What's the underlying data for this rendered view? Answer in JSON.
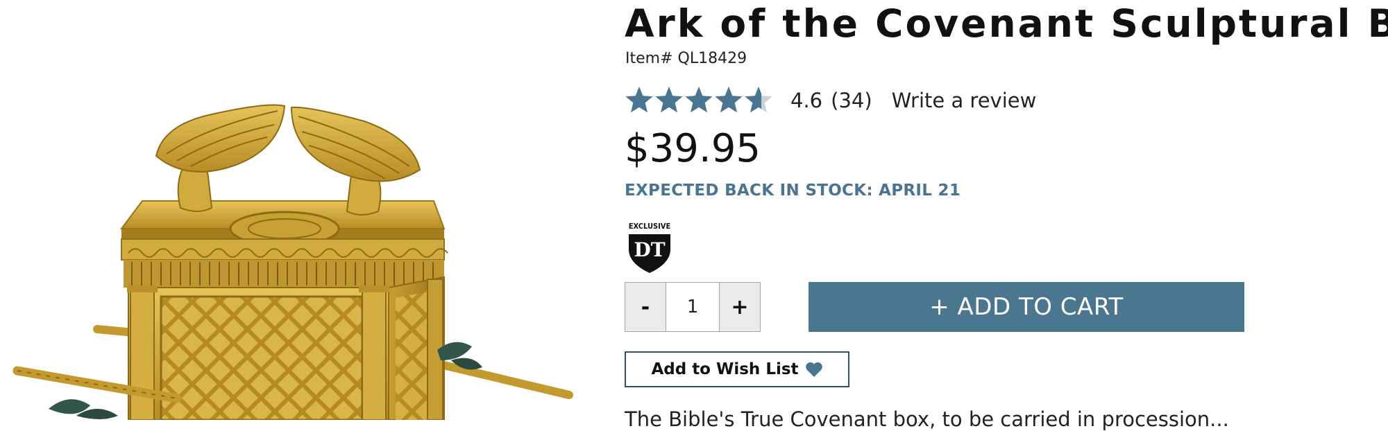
{
  "product": {
    "title": "Ark of the Covenant Sculptural Box",
    "item_number": "Item# QL18429",
    "rating": 4.6,
    "rating_score_text": "4.6",
    "rating_count_text": "(34)",
    "write_review_label": "Write a review",
    "price": "$39.95",
    "stock_status": "EXPECTED BACK IN STOCK: APRIL 21",
    "badge_text": "EXCLUSIVE",
    "badge_initials": "DT",
    "image_alt": "Gold Ark of the Covenant sculptural box with winged cherubim and carrying poles"
  },
  "purchase": {
    "qty_minus_label": "-",
    "qty_value": "1",
    "qty_plus_label": "+",
    "add_to_cart_label": "+ ADD TO CART",
    "wishlist_label": "Add to Wish List"
  },
  "description_text": "The Bible's True Covenant box, to be carried in procession...",
  "icons": {
    "star": "star-icon",
    "heart": "heart-icon",
    "badge": "exclusive-badge-icon"
  },
  "colors": {
    "accent": "#4a768f",
    "stock_text": "#4a7590",
    "star_filled": "#4a7590",
    "star_empty": "#c7d3db",
    "gold": "#c9a233"
  }
}
